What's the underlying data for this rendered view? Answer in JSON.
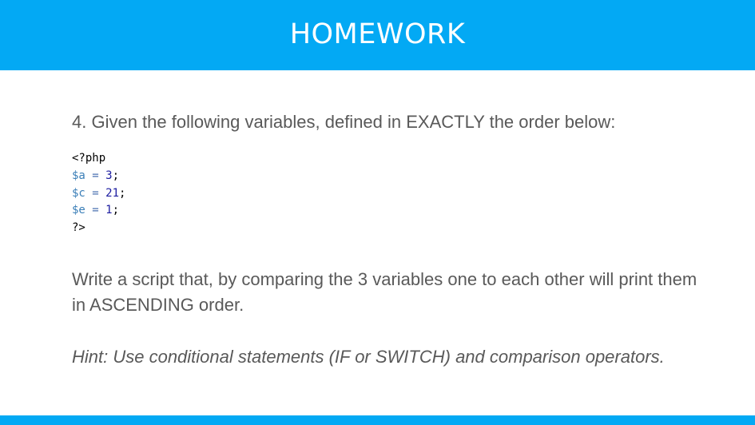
{
  "header": {
    "title": "HOMEWORK"
  },
  "content": {
    "intro": "4. Given the following variables, defined in EXACTLY the order below:",
    "code": {
      "open_tag": "<?php",
      "lines": [
        {
          "var": "$a",
          "op": "=",
          "num": "3",
          "end": ";"
        },
        {
          "var": "$c",
          "op": "=",
          "num": "21",
          "end": ";"
        },
        {
          "var": "$e",
          "op": "=",
          "num": "1",
          "end": ";"
        }
      ],
      "close_tag": "?>"
    },
    "task": "Write a script that, by comparing the 3 variables one to each other will print them in ASCENDING order.",
    "hint": "Hint: Use conditional statements (IF or SWITCH) and comparison operators."
  },
  "colors": {
    "accent": "#03a9f4",
    "body_text": "#595959",
    "code_variable": "#3b7fb8",
    "code_number": "#1c1ca0"
  }
}
